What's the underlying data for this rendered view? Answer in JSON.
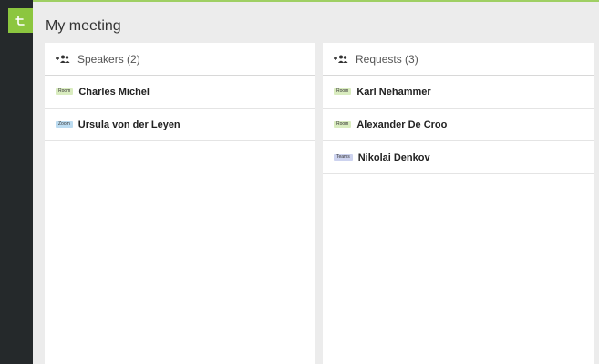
{
  "meeting": {
    "title": "My meeting"
  },
  "speakers": {
    "header": "Speakers (2)",
    "items": [
      {
        "badge": "Room",
        "platform": "room",
        "name": "Charles Michel"
      },
      {
        "badge": "Zoom",
        "platform": "zoom",
        "name": "Ursula von der Leyen"
      }
    ]
  },
  "requests": {
    "header": "Requests (3)",
    "items": [
      {
        "badge": "Room",
        "platform": "room",
        "name": "Karl Nehammer"
      },
      {
        "badge": "Room",
        "platform": "room",
        "name": "Alexander De Croo"
      },
      {
        "badge": "Teams",
        "platform": "teams",
        "name": "Nikolai Denkov"
      }
    ]
  },
  "colors": {
    "accent": "#8cc63f",
    "sidebar": "#25292b",
    "room_badge": "#d9ecbf",
    "zoom_badge": "#bcdcf1",
    "teams_badge": "#cdd3ef"
  },
  "icons": {
    "logo": "app-logo-icon",
    "speakers": "add-users-icon",
    "requests": "add-users-icon"
  }
}
